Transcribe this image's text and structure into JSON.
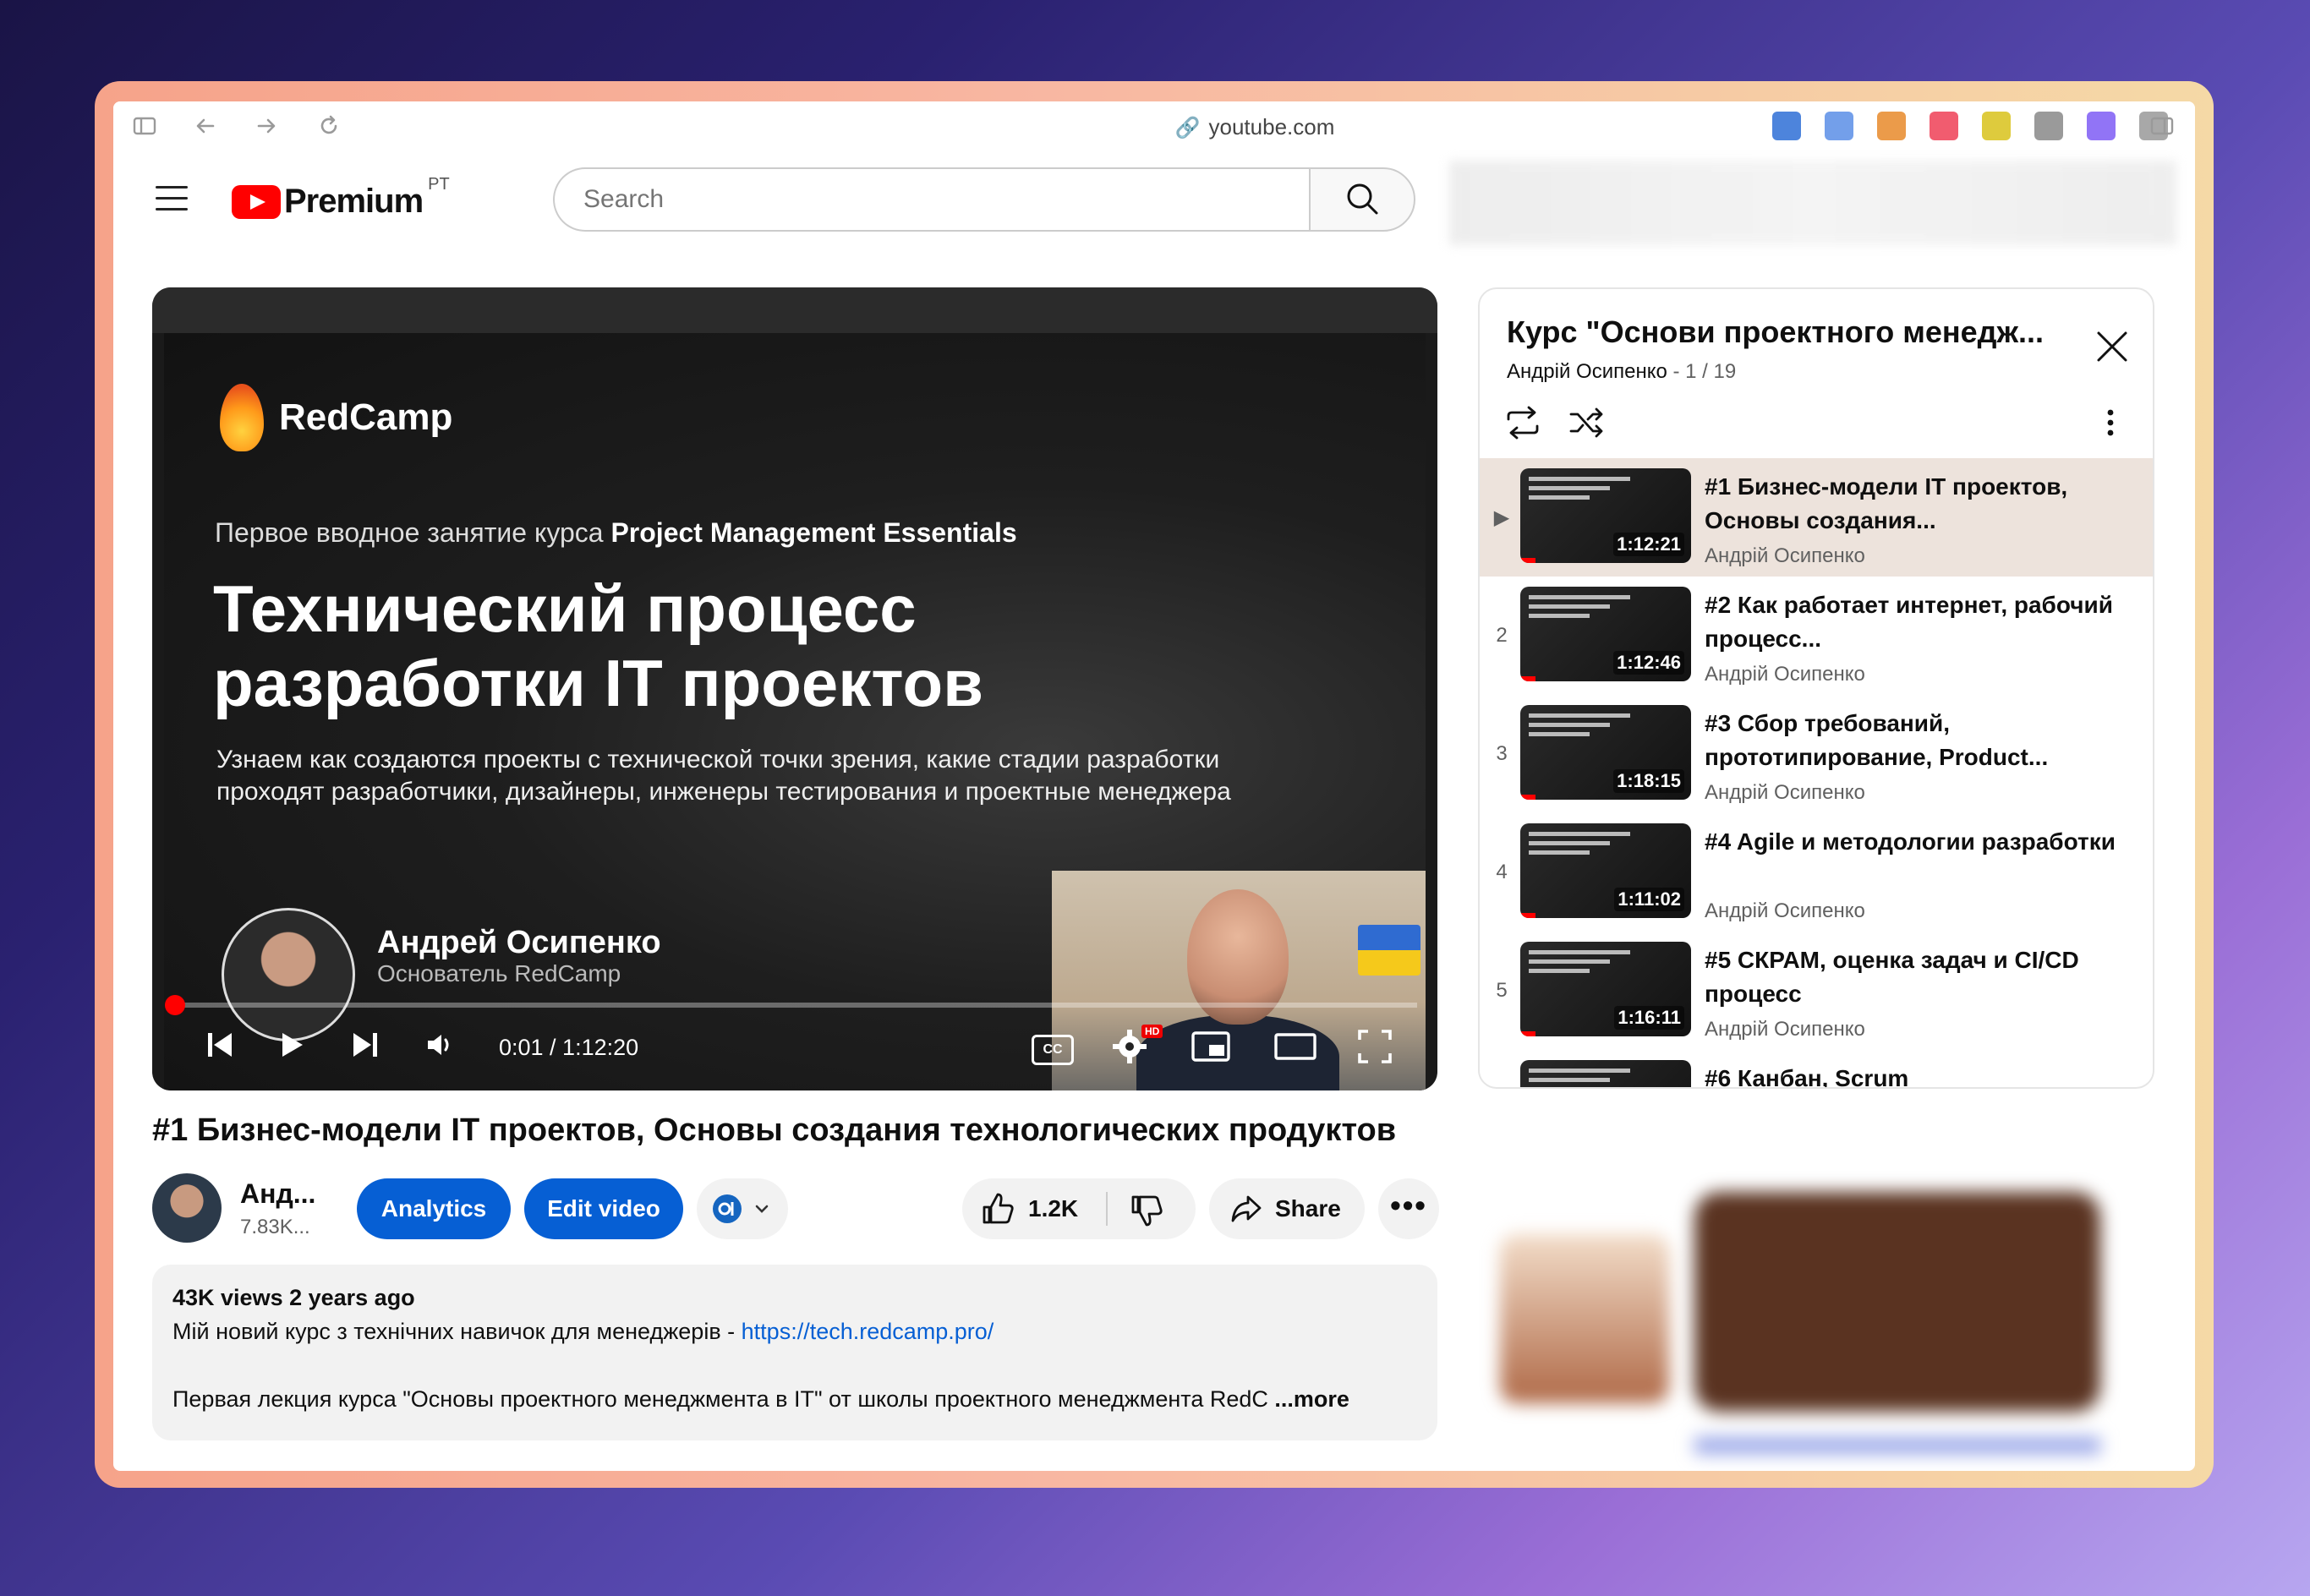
{
  "browser": {
    "url": "youtube.com",
    "extensions": [
      {
        "icon": "privacy-icon",
        "color": "#2e6fd6"
      },
      {
        "icon": "translate-icon",
        "color": "#5a8ee6"
      },
      {
        "icon": "fox-icon",
        "color": "#e88a2a"
      },
      {
        "icon": "pocket-icon",
        "color": "#ef3f56"
      },
      {
        "icon": "r-yellow-icon",
        "color": "#d8c21b"
      },
      {
        "icon": "r-grey-icon",
        "color": "#888888"
      },
      {
        "icon": "robot-icon",
        "color": "#7e5cf4"
      },
      {
        "icon": "rules-icon",
        "color": "#999999"
      }
    ]
  },
  "header": {
    "logo_word": "Premium",
    "logo_country": "PT",
    "search_placeholder": "Search"
  },
  "video": {
    "brand": "RedCamp",
    "subtitle_prefix": "Первое вводное занятие курса",
    "subtitle_course": "Project Management Essentials",
    "title_line1": "Технический процесс",
    "title_line2": "разработки IT проектов",
    "desc_line1": "Узнаем как создаются проекты с технической точки зрения, какие стадии разработки",
    "desc_line2": "проходят разработчики, дизайнеры, инженеры тестирования и проектные менеджера",
    "presenter_name": "Андрей Осипенко",
    "presenter_role": "Основатель RedCamp",
    "time": "0:01 / 1:12:20",
    "cc_label": "CC",
    "hd_label": "HD",
    "progress": 0.001
  },
  "meta": {
    "title": "#1 Бизнес-модели IT проектов, Основы создания технологических продуктов",
    "channel_name": "Анд...",
    "channel_subs": "7.83K...",
    "analytics": "Analytics",
    "edit_video": "Edit video",
    "likes": "1.2K",
    "share": "Share"
  },
  "description": {
    "stats": "43K views  2 years ago",
    "line1_text": "Мій новий курс з технічних навичок для менеджерів - ",
    "line1_link": "https://tech.redcamp.pro/",
    "line2_text": "Первая лекция курса \"Основы проектного менеджмента в IT\" от школы проектного менеджмента RedC",
    "more": "...more"
  },
  "playlist": {
    "title": "Курс \"Основи проектного менедж...",
    "author": "Андрій Осипенко",
    "counter": " - 1 / 19",
    "items": [
      {
        "idx": "▶",
        "title": "#1 Бизнес-модели IT проектов, Основы создания...",
        "author": "Андрій Осипенко",
        "duration": "1:12:21",
        "active": true
      },
      {
        "idx": "2",
        "title": "#2 Как работает интернет, рабочий процесс...",
        "author": "Андрій Осипенко",
        "duration": "1:12:46",
        "active": false
      },
      {
        "idx": "3",
        "title": "#3 Сбор требований, прототипирование, Product...",
        "author": "Андрій Осипенко",
        "duration": "1:18:15",
        "active": false
      },
      {
        "idx": "4",
        "title": "#4 Agile и методологии разработки",
        "author": "Андрій Осипенко",
        "duration": "1:11:02",
        "active": false
      },
      {
        "idx": "5",
        "title": "#5 СКРАМ, оценка задач и CI/CD процесс",
        "author": "Андрій Осипенко",
        "duration": "1:16:11",
        "active": false
      },
      {
        "idx": "",
        "title": "#6 Канбан, Scrum",
        "author": "",
        "duration": "",
        "active": false
      }
    ]
  }
}
